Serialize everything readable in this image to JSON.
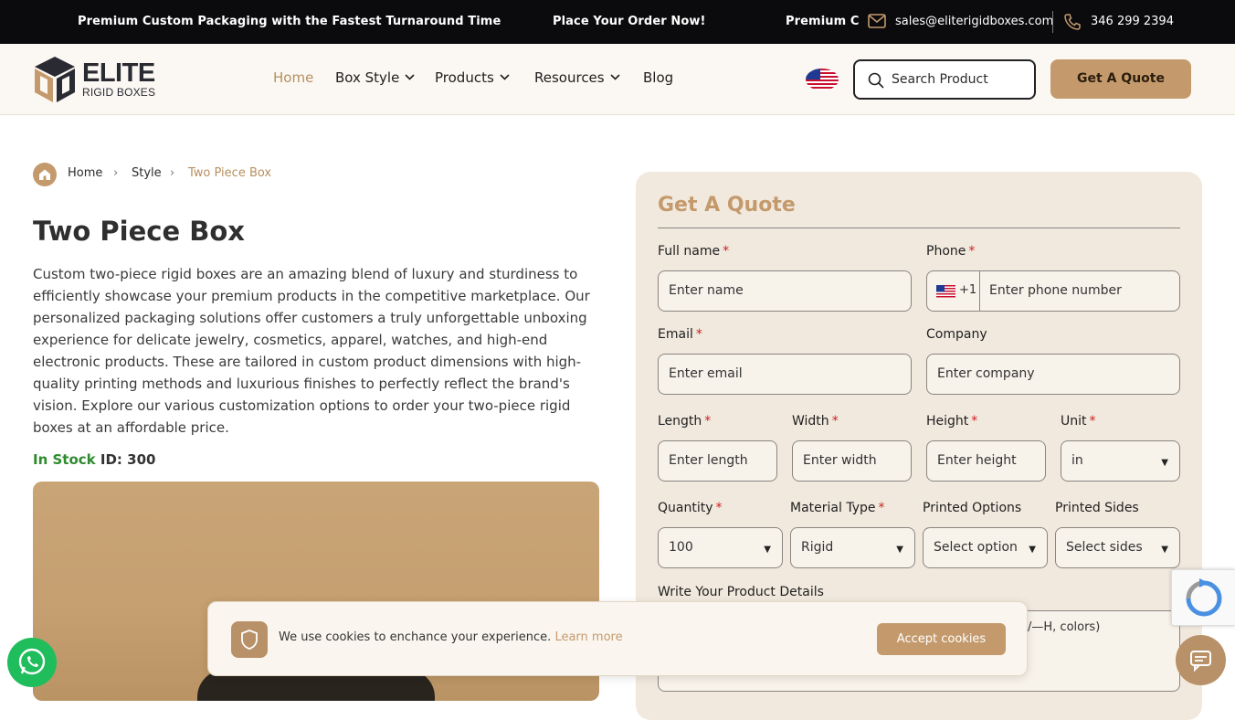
{
  "topbar": {
    "marquee": [
      "Premium Custom Packaging with the Fastest Turnaround Time",
      "Place Your Order Now!",
      "Premium Custom Packaging with the Fastest Turnaround Time"
    ],
    "email": "sales@eliterigidboxes.com",
    "phone": "346 299 2394"
  },
  "header": {
    "logo_name": "ELITE",
    "logo_sub": "RIGID BOXES",
    "nav": [
      {
        "label": "Home",
        "active": true
      },
      {
        "label": "Box Style",
        "dropdown": true
      },
      {
        "label": "Products",
        "dropdown": true
      },
      {
        "label": "Resources",
        "dropdown": true
      },
      {
        "label": "Blog"
      }
    ],
    "search_label": "Search Product",
    "quote_button": "Get A Quote"
  },
  "breadcrumb": {
    "items": [
      "Home",
      "Style",
      "Two Piece Box"
    ]
  },
  "product": {
    "title": "Two Piece Box",
    "description": "Custom two-piece rigid boxes are an amazing blend of luxury and sturdiness to efficiently showcase your premium products in the competitive marketplace. Our personalized packaging solutions offer customers a truly unforgettable unboxing experience for delicate jewelry, cosmetics, apparel, watches, and high-end electronic products. These are tailored in custom product dimensions with high-quality printing methods and luxurious finishes to perfectly reflect the brand's vision. Explore our various customization options to order your two-piece rigid boxes at an affordable price.",
    "stock": "In Stock",
    "id_label": "ID: 300"
  },
  "quote_form": {
    "title": "Get A Quote",
    "full_name": {
      "label": "Full name",
      "placeholder": "Enter name"
    },
    "phone": {
      "label": "Phone",
      "code": "+1",
      "placeholder": "Enter phone number"
    },
    "email": {
      "label": "Email",
      "placeholder": "Enter email"
    },
    "company": {
      "label": "Company",
      "placeholder": "Enter company"
    },
    "length": {
      "label": "Length",
      "placeholder": "Enter length"
    },
    "width": {
      "label": "Width",
      "placeholder": "Enter width"
    },
    "height": {
      "label": "Height",
      "placeholder": "Enter height"
    },
    "unit": {
      "label": "Unit",
      "value": "in"
    },
    "quantity": {
      "label": "Quantity",
      "value": "100"
    },
    "material": {
      "label": "Material Type",
      "value": "Rigid"
    },
    "printed_options": {
      "label": "Printed Options",
      "value": "Select option"
    },
    "printed_sides": {
      "label": "Printed Sides",
      "value": "Select sides"
    },
    "details": {
      "label": "Write Your Product Details",
      "placeholder_visible": "/—H, colors)"
    }
  },
  "cookie": {
    "text": "We use cookies to enchance your experience.",
    "learn_more": "Learn more",
    "accept": "Accept cookies"
  },
  "colors": {
    "accent": "#c49a6c",
    "dark": "#0b0b0e",
    "required": "#cc1f1f",
    "stock": "#2e8b2e"
  }
}
